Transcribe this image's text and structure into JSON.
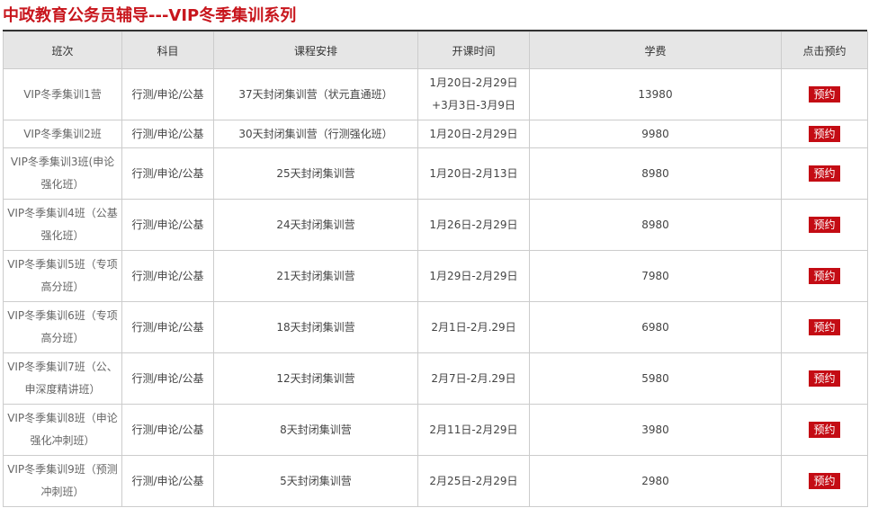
{
  "page": {
    "title": "中政教育公务员辅导---VIP冬季集训系列"
  },
  "table": {
    "headers": [
      "班次",
      "科目",
      "课程安排",
      "开课时间",
      "学费",
      "点击预约"
    ],
    "book_label": "预约",
    "rows": [
      {
        "class": "VIP冬季集训1营",
        "subject": "行测/申论/公基",
        "arrangement": "37天封闭集训营（状元直通班）",
        "start": "1月20日-2月29日+3月3日-3月9日",
        "fee": "13980"
      },
      {
        "class": "VIP冬季集训2班",
        "subject": "行测/申论/公基",
        "arrangement": "30天封闭集训营（行测强化班）",
        "start": "1月20日-2月29日",
        "fee": "9980"
      },
      {
        "class": "VIP冬季集训3班(申论强化班）",
        "subject": "行测/申论/公基",
        "arrangement": "25天封闭集训营",
        "start": "1月20日-2月13日",
        "fee": "8980"
      },
      {
        "class": "VIP冬季集训4班（公基强化班）",
        "subject": "行测/申论/公基",
        "arrangement": "24天封闭集训营",
        "start": "1月26日-2月29日",
        "fee": "8980"
      },
      {
        "class": "VIP冬季集训5班（专项高分班）",
        "subject": "行测/申论/公基",
        "arrangement": "21天封闭集训营",
        "start": "1月29日-2月29日",
        "fee": "7980"
      },
      {
        "class": "VIP冬季集训6班（专项高分班）",
        "subject": "行测/申论/公基",
        "arrangement": "18天封闭集训营",
        "start": "2月1日-2月.29日",
        "fee": "6980"
      },
      {
        "class": "VIP冬季集训7班（公、申深度精讲班）",
        "subject": "行测/申论/公基",
        "arrangement": "12天封闭集训营",
        "start": "2月7日-2月.29日",
        "fee": "5980"
      },
      {
        "class": "VIP冬季集训8班（申论强化冲刺班）",
        "subject": "行测/申论/公基",
        "arrangement": "8天封闭集训营",
        "start": "2月11日-2月29日",
        "fee": "3980"
      },
      {
        "class": "VIP冬季集训9班（预测冲刺班）",
        "subject": "行测/申论/公基",
        "arrangement": "5天封闭集训营",
        "start": "2月25日-2月29日",
        "fee": "2980"
      }
    ]
  },
  "colors": {
    "title": "#c8161d",
    "header_bg": "#e6e6e6",
    "button_bg": "#c40c14",
    "border": "#cccccc"
  }
}
